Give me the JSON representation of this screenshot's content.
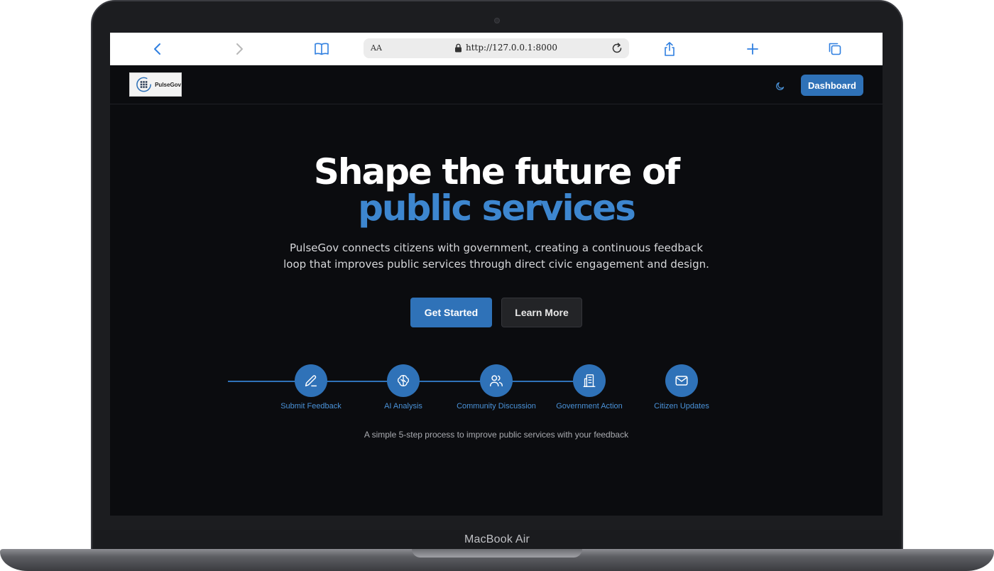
{
  "browser": {
    "text_size_label": "AA",
    "url": "http://127.0.0.1:8000"
  },
  "header": {
    "logo_text": "PulseGov",
    "dashboard_label": "Dashboard"
  },
  "hero": {
    "title_line1": "Shape the future of",
    "title_line2": "public services",
    "subtitle": "PulseGov connects citizens with government, creating a continuous feedback loop that improves public services through direct civic engagement and design.",
    "primary_cta": "Get Started",
    "secondary_cta": "Learn More"
  },
  "steps": {
    "items": [
      {
        "label": "Submit Feedback",
        "icon": "pencil-icon"
      },
      {
        "label": "AI Analysis",
        "icon": "brain-icon"
      },
      {
        "label": "Community Discussion",
        "icon": "users-icon"
      },
      {
        "label": "Government Action",
        "icon": "building-icon"
      },
      {
        "label": "Citizen Updates",
        "icon": "mail-icon"
      }
    ],
    "caption": "A simple 5-step process to improve public services with your feedback"
  },
  "device": {
    "model_label": "MacBook Air"
  },
  "colors": {
    "accent": "#2f72b8",
    "accent_text": "#3d86cf",
    "page_background": "#0b0c0f"
  }
}
